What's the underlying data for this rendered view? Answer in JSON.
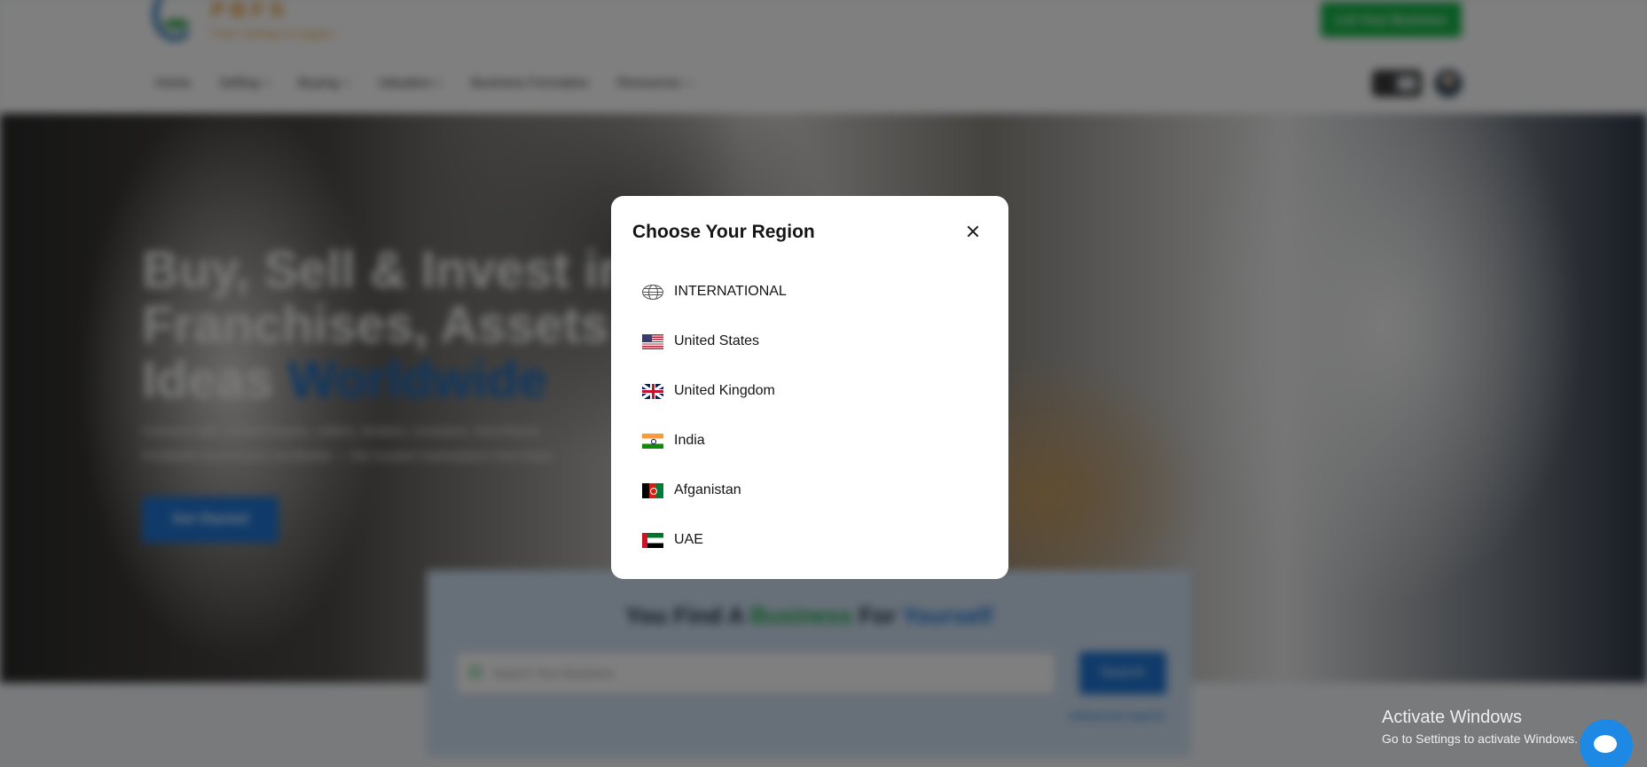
{
  "header": {
    "logo_text": "PBFS",
    "logo_tagline": "From Listings to Legacy",
    "list_business_label": "List Your Business",
    "nav": [
      {
        "label": "Home"
      },
      {
        "label": "Selling"
      },
      {
        "label": "Buying"
      },
      {
        "label": "Valuation"
      },
      {
        "label": "Business Formation"
      },
      {
        "label": "Resources"
      }
    ]
  },
  "hero": {
    "title_line1": "Buy, Sell & Invest in",
    "title_line2": "Franchises, Assets &",
    "title_line3_plain": "Ideas ",
    "title_line3_highlight": "Worldwide",
    "subtitle_line1": "Connect with verified buyers, sellers, brokers, investors, franchisors",
    "subtitle_line2": "Profitable businesses worldwide — the trusted marketplace that helps",
    "cta_label": "Get Started"
  },
  "search": {
    "heading_part1": "You Find A ",
    "heading_part2": "Business",
    "heading_part3": " For ",
    "heading_part4": "Yourself",
    "placeholder": "Search Your Business",
    "button_label": "Search",
    "advanced_label": "Advanced search"
  },
  "modal": {
    "title": "Choose Your Region",
    "regions": [
      {
        "label": "INTERNATIONAL",
        "flag": "globe-icon"
      },
      {
        "label": "United States",
        "flag": "us-flag-icon"
      },
      {
        "label": "United Kingdom",
        "flag": "uk-flag-icon"
      },
      {
        "label": "India",
        "flag": "india-flag-icon"
      },
      {
        "label": "Afganistan",
        "flag": "afghanistan-flag-icon"
      },
      {
        "label": "UAE",
        "flag": "uae-flag-icon"
      }
    ]
  },
  "watermark": {
    "line1": "Activate Windows",
    "line2": "Go to Settings to activate Windows."
  },
  "colors": {
    "primary_blue": "#1f75d4",
    "brand_green": "#17b64a",
    "brand_orange": "#e7962a",
    "overlay": "rgba(0,0,0,0.5)"
  }
}
